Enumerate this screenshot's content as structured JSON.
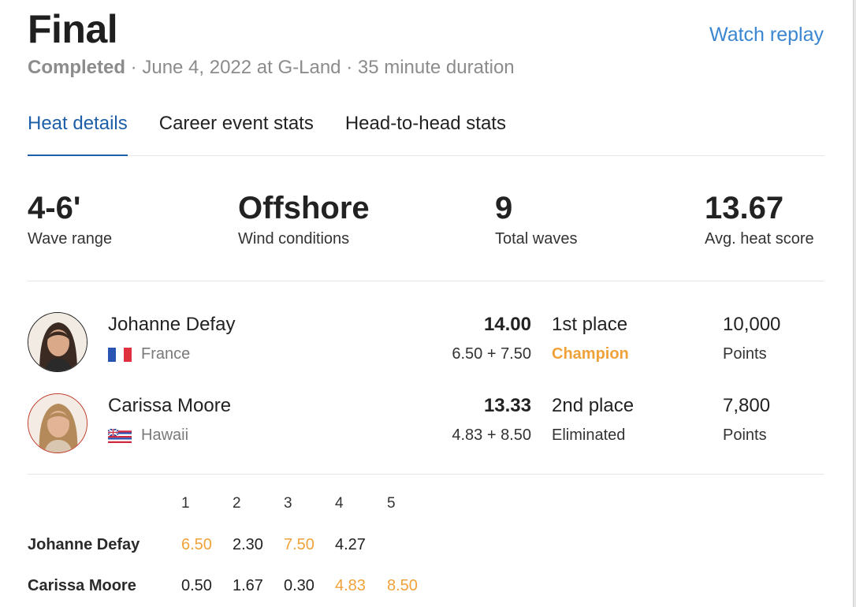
{
  "header": {
    "title": "Final",
    "watch_replay": "Watch replay",
    "status": "Completed",
    "details": " · June 4, 2022 at G-Land · 35 minute duration"
  },
  "tabs": [
    {
      "label": "Heat details",
      "active": true
    },
    {
      "label": "Career event stats",
      "active": false
    },
    {
      "label": "Head-to-head stats",
      "active": false
    }
  ],
  "stats": [
    {
      "value": "4-6'",
      "label": "Wave range"
    },
    {
      "value": "Offshore",
      "label": "Wind conditions"
    },
    {
      "value": "9",
      "label": "Total waves"
    },
    {
      "value": "13.67",
      "label": "Avg. heat score"
    }
  ],
  "surfers": [
    {
      "name": "Johanne Defay",
      "country": "France",
      "flag_icon": "france-flag-icon",
      "total": "14.00",
      "breakdown": "6.50 + 7.50",
      "place": "1st place",
      "result": "Champion",
      "points": "10,000",
      "points_label": "Points"
    },
    {
      "name": "Carissa Moore",
      "country": "Hawaii",
      "flag_icon": "hawaii-flag-icon",
      "total": "13.33",
      "breakdown": "4.83 + 8.50",
      "place": "2nd place",
      "result": "Eliminated",
      "points": "7,800",
      "points_label": "Points"
    }
  ],
  "waves": {
    "headers": [
      "1",
      "2",
      "3",
      "4",
      "5"
    ],
    "rows": [
      {
        "name": "Johanne Defay",
        "scores": [
          "6.50",
          "2.30",
          "7.50",
          "4.27"
        ],
        "counting": [
          true,
          false,
          true,
          false
        ]
      },
      {
        "name": "Carissa Moore",
        "scores": [
          "0.50",
          "1.67",
          "0.30",
          "4.83",
          "8.50"
        ],
        "counting": [
          false,
          false,
          false,
          true,
          true
        ]
      }
    ]
  },
  "colors": {
    "accent_blue": "#1c5fa8",
    "link_blue": "#3a86d1",
    "highlight_orange": "#f0a23a"
  }
}
